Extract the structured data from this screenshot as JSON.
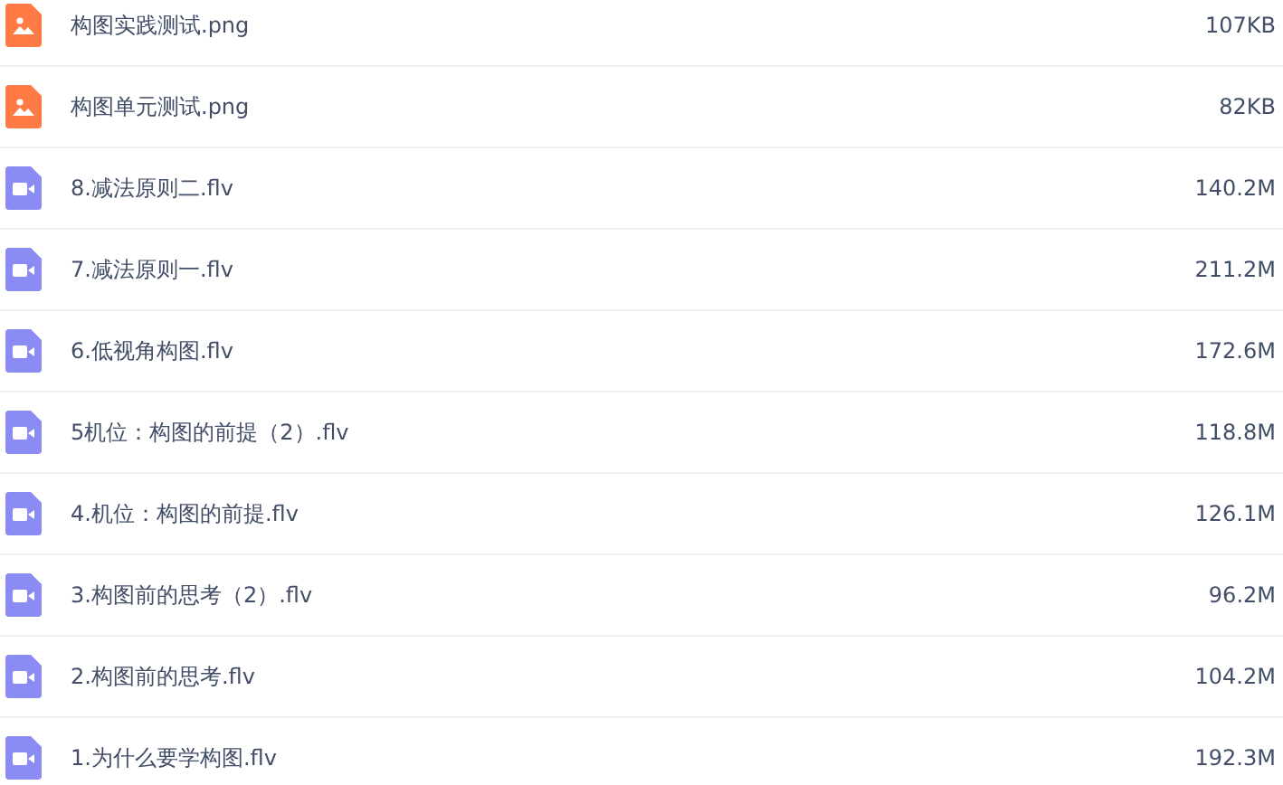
{
  "files": [
    {
      "kind": "image",
      "name": "构图实践测试.png",
      "size": "107KB"
    },
    {
      "kind": "image",
      "name": "构图单元测试.png",
      "size": "82KB"
    },
    {
      "kind": "video",
      "name": "8.减法原则二.flv",
      "size": "140.2M"
    },
    {
      "kind": "video",
      "name": "7.减法原则一.flv",
      "size": "211.2M"
    },
    {
      "kind": "video",
      "name": "6.低视角构图.flv",
      "size": "172.6M"
    },
    {
      "kind": "video",
      "name": "5机位：构图的前提（2）.flv",
      "size": "118.8M"
    },
    {
      "kind": "video",
      "name": "4.机位：构图的前提.flv",
      "size": "126.1M"
    },
    {
      "kind": "video",
      "name": "3.构图前的思考（2）.flv",
      "size": "96.2M"
    },
    {
      "kind": "video",
      "name": "2.构图前的思考.flv",
      "size": "104.2M"
    },
    {
      "kind": "video",
      "name": "1.为什么要学构图.flv",
      "size": "192.3M"
    }
  ]
}
